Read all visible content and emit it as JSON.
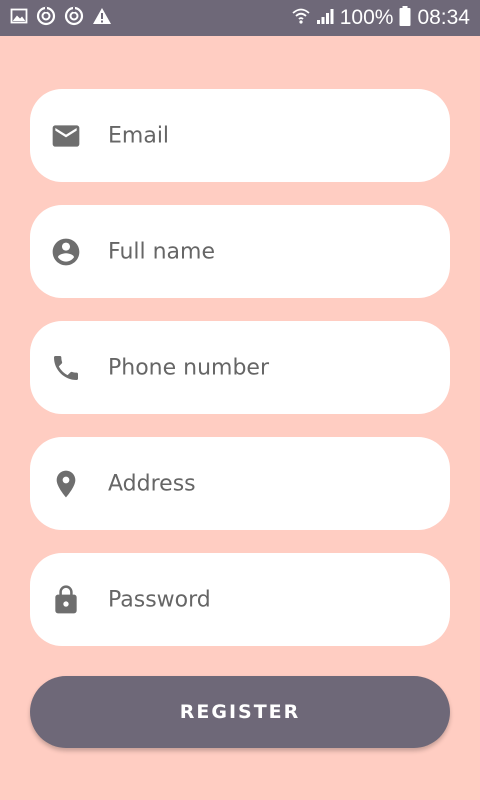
{
  "status_bar": {
    "battery_percent": "100%",
    "time": "08:34",
    "icons": [
      "image-icon",
      "sync-icon",
      "sync-icon",
      "warning-icon",
      "wifi-icon",
      "signal-icon",
      "battery-icon"
    ]
  },
  "form": {
    "fields": [
      {
        "placeholder": "Email",
        "icon": "email-icon"
      },
      {
        "placeholder": "Full name",
        "icon": "account-circle-icon"
      },
      {
        "placeholder": "Phone number",
        "icon": "phone-icon"
      },
      {
        "placeholder": "Address",
        "icon": "location-pin-icon"
      },
      {
        "placeholder": "Password",
        "icon": "lock-icon"
      }
    ],
    "register_label": "REGISTER"
  },
  "colors": {
    "background": "#ffcdc2",
    "status_bar": "#6e6878",
    "field_background": "#ffffff",
    "icon": "#6e6e6e",
    "placeholder_text": "#666666",
    "button": "#6e6878",
    "button_text": "#ffffff"
  }
}
